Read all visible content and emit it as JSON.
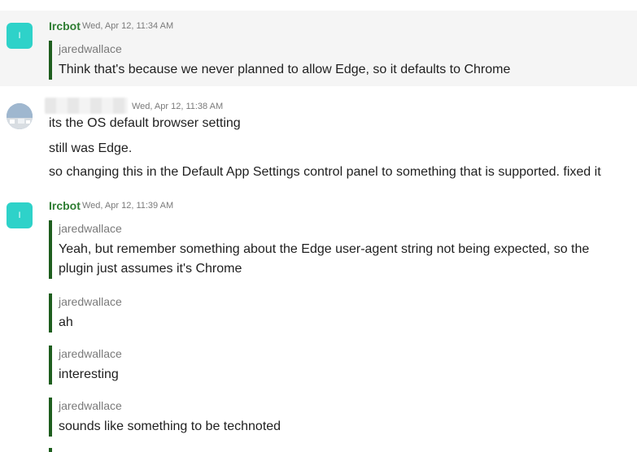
{
  "messages": [
    {
      "author": "Ircbot",
      "avatar_letter": "I",
      "time": "Wed, Apr 12, 11:34 AM",
      "quotes": [
        {
          "author": "jaredwallace",
          "text": "Think that's because we never planned to allow Edge, so it defaults to Chrome"
        }
      ]
    },
    {
      "author": "",
      "time": "Wed, Apr 12, 11:38 AM",
      "lines": [
        "its the OS default browser setting",
        "still was Edge.",
        "so changing this in the Default App Settings control panel to something that is supported. fixed it"
      ]
    },
    {
      "author": "Ircbot",
      "avatar_letter": "I",
      "time": "Wed, Apr 12, 11:39 AM",
      "quotes": [
        {
          "author": "jaredwallace",
          "text": "Yeah, but remember something about the Edge user-agent string not being expected, so the plugin just assumes it's Chrome"
        },
        {
          "author": "jaredwallace",
          "text": "ah"
        },
        {
          "author": "jaredwallace",
          "text": "interesting"
        },
        {
          "author": "jaredwallace",
          "text": "sounds like something to be technoted"
        }
      ]
    }
  ],
  "colors": {
    "bot_avatar": "#2ed2c9",
    "author_name": "#2e7d32",
    "quote_bar": "#1e5e1e",
    "hover_background": "#f5f5f5"
  }
}
